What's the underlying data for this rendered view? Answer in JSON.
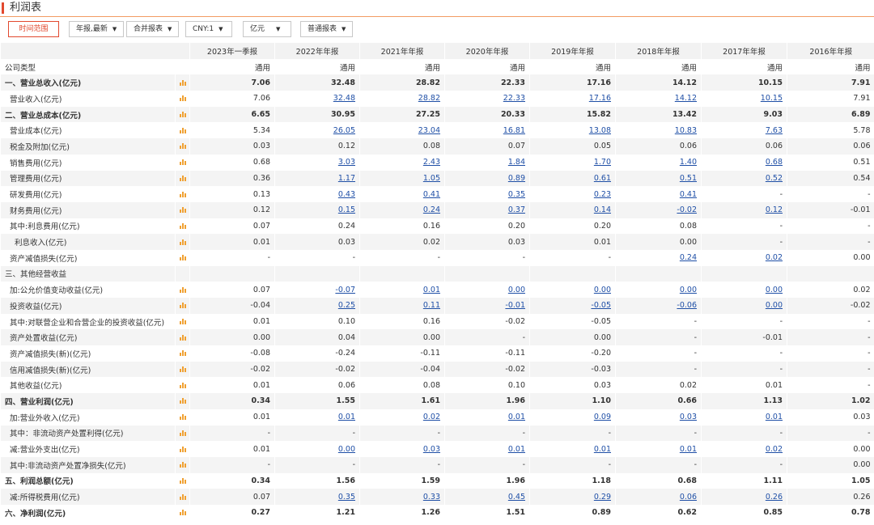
{
  "page_title": "利润表",
  "toolbar": {
    "range_button": "时间范围",
    "report_select": "年报,最新",
    "statement_select": "合并报表",
    "currency_select": "CNY:1",
    "unit_select": "亿元",
    "type_select": "普通报表"
  },
  "columns": [
    "2023年一季报",
    "2022年年报",
    "2021年年报",
    "2020年年报",
    "2019年年报",
    "2018年年报",
    "2017年年报",
    "2016年年报"
  ],
  "rows": [
    {
      "label": "公司类型",
      "bold": false,
      "indent": 0,
      "icon": false,
      "values": [
        "通用",
        "通用",
        "通用",
        "通用",
        "通用",
        "通用",
        "通用",
        "通用"
      ],
      "links": [
        0,
        0,
        0,
        0,
        0,
        0,
        0,
        0
      ]
    },
    {
      "label": "一、营业总收入(亿元)",
      "bold": true,
      "indent": 0,
      "icon": true,
      "values": [
        "7.06",
        "32.48",
        "28.82",
        "22.33",
        "17.16",
        "14.12",
        "10.15",
        "7.91"
      ],
      "links": [
        0,
        0,
        0,
        0,
        0,
        0,
        0,
        0
      ]
    },
    {
      "label": "营业收入(亿元)",
      "bold": false,
      "indent": 1,
      "icon": true,
      "values": [
        "7.06",
        "32.48",
        "28.82",
        "22.33",
        "17.16",
        "14.12",
        "10.15",
        "7.91"
      ],
      "links": [
        0,
        1,
        1,
        1,
        1,
        1,
        1,
        0
      ]
    },
    {
      "label": "二、营业总成本(亿元)",
      "bold": true,
      "indent": 0,
      "icon": true,
      "values": [
        "6.65",
        "30.95",
        "27.25",
        "20.33",
        "15.82",
        "13.42",
        "9.03",
        "6.89"
      ],
      "links": [
        0,
        0,
        0,
        0,
        0,
        0,
        0,
        0
      ]
    },
    {
      "label": "营业成本(亿元)",
      "bold": false,
      "indent": 1,
      "icon": true,
      "values": [
        "5.34",
        "26.05",
        "23.04",
        "16.81",
        "13.08",
        "10.83",
        "7.63",
        "5.78"
      ],
      "links": [
        0,
        1,
        1,
        1,
        1,
        1,
        1,
        0
      ]
    },
    {
      "label": "税金及附加(亿元)",
      "bold": false,
      "indent": 1,
      "icon": true,
      "values": [
        "0.03",
        "0.12",
        "0.08",
        "0.07",
        "0.05",
        "0.06",
        "0.06",
        "0.06"
      ],
      "links": [
        0,
        0,
        0,
        0,
        0,
        0,
        0,
        0
      ]
    },
    {
      "label": "销售费用(亿元)",
      "bold": false,
      "indent": 1,
      "icon": true,
      "values": [
        "0.68",
        "3.03",
        "2.43",
        "1.84",
        "1.70",
        "1.40",
        "0.68",
        "0.51"
      ],
      "links": [
        0,
        1,
        1,
        1,
        1,
        1,
        1,
        0
      ]
    },
    {
      "label": "管理费用(亿元)",
      "bold": false,
      "indent": 1,
      "icon": true,
      "values": [
        "0.36",
        "1.17",
        "1.05",
        "0.89",
        "0.61",
        "0.51",
        "0.52",
        "0.54"
      ],
      "links": [
        0,
        1,
        1,
        1,
        1,
        1,
        1,
        0
      ]
    },
    {
      "label": "研发费用(亿元)",
      "bold": false,
      "indent": 1,
      "icon": true,
      "values": [
        "0.13",
        "0.43",
        "0.41",
        "0.35",
        "0.23",
        "0.41",
        "-",
        "-"
      ],
      "links": [
        0,
        1,
        1,
        1,
        1,
        1,
        0,
        0
      ]
    },
    {
      "label": "财务费用(亿元)",
      "bold": false,
      "indent": 1,
      "icon": true,
      "values": [
        "0.12",
        "0.15",
        "0.24",
        "0.37",
        "0.14",
        "-0.02",
        "0.12",
        "-0.01"
      ],
      "links": [
        0,
        1,
        1,
        1,
        1,
        1,
        1,
        0
      ]
    },
    {
      "label": "其中:利息费用(亿元)",
      "bold": false,
      "indent": 1,
      "icon": true,
      "values": [
        "0.07",
        "0.24",
        "0.16",
        "0.20",
        "0.20",
        "0.08",
        "-",
        "-"
      ],
      "links": [
        0,
        0,
        0,
        0,
        0,
        0,
        0,
        0
      ]
    },
    {
      "label": "利息收入(亿元)",
      "bold": false,
      "indent": 2,
      "icon": true,
      "values": [
        "0.01",
        "0.03",
        "0.02",
        "0.03",
        "0.01",
        "0.00",
        "-",
        "-"
      ],
      "links": [
        0,
        0,
        0,
        0,
        0,
        0,
        0,
        0
      ]
    },
    {
      "label": "资产减值损失(亿元)",
      "bold": false,
      "indent": 1,
      "icon": true,
      "values": [
        "-",
        "-",
        "-",
        "-",
        "-",
        "0.24",
        "0.02",
        "0.00"
      ],
      "links": [
        0,
        0,
        0,
        0,
        0,
        1,
        1,
        0
      ]
    },
    {
      "label": "三、其他经营收益",
      "bold": false,
      "indent": 0,
      "icon": false,
      "values": [
        "",
        "",
        "",
        "",
        "",
        "",
        "",
        ""
      ],
      "links": [
        0,
        0,
        0,
        0,
        0,
        0,
        0,
        0
      ]
    },
    {
      "label": "加:公允价值变动收益(亿元)",
      "bold": false,
      "indent": 1,
      "icon": true,
      "values": [
        "0.07",
        "-0.07",
        "0.01",
        "0.00",
        "0.00",
        "0.00",
        "0.00",
        "0.02"
      ],
      "links": [
        0,
        1,
        1,
        1,
        1,
        1,
        1,
        0
      ]
    },
    {
      "label": "投资收益(亿元)",
      "bold": false,
      "indent": 1,
      "icon": true,
      "values": [
        "-0.04",
        "0.25",
        "0.11",
        "-0.01",
        "-0.05",
        "-0.06",
        "0.00",
        "-0.02"
      ],
      "links": [
        0,
        1,
        1,
        1,
        1,
        1,
        1,
        0
      ]
    },
    {
      "label": "其中:对联营企业和合营企业的投资收益(亿元)",
      "bold": false,
      "indent": 1,
      "icon": true,
      "values": [
        "0.01",
        "0.10",
        "0.16",
        "-0.02",
        "-0.05",
        "-",
        "-",
        "-"
      ],
      "links": [
        0,
        0,
        0,
        0,
        0,
        0,
        0,
        0
      ]
    },
    {
      "label": "资产处置收益(亿元)",
      "bold": false,
      "indent": 1,
      "icon": true,
      "values": [
        "0.00",
        "0.04",
        "0.00",
        "-",
        "0.00",
        "-",
        "-0.01",
        "-"
      ],
      "links": [
        0,
        0,
        0,
        0,
        0,
        0,
        0,
        0
      ]
    },
    {
      "label": "资产减值损失(新)(亿元)",
      "bold": false,
      "indent": 1,
      "icon": true,
      "values": [
        "-0.08",
        "-0.24",
        "-0.11",
        "-0.11",
        "-0.20",
        "-",
        "-",
        "-"
      ],
      "links": [
        0,
        0,
        0,
        0,
        0,
        0,
        0,
        0
      ]
    },
    {
      "label": "信用减值损失(新)(亿元)",
      "bold": false,
      "indent": 1,
      "icon": true,
      "values": [
        "-0.02",
        "-0.02",
        "-0.04",
        "-0.02",
        "-0.03",
        "-",
        "-",
        "-"
      ],
      "links": [
        0,
        0,
        0,
        0,
        0,
        0,
        0,
        0
      ]
    },
    {
      "label": "其他收益(亿元)",
      "bold": false,
      "indent": 1,
      "icon": true,
      "values": [
        "0.01",
        "0.06",
        "0.08",
        "0.10",
        "0.03",
        "0.02",
        "0.01",
        "-"
      ],
      "links": [
        0,
        0,
        0,
        0,
        0,
        0,
        0,
        0
      ]
    },
    {
      "label": "四、营业利润(亿元)",
      "bold": true,
      "indent": 0,
      "icon": true,
      "values": [
        "0.34",
        "1.55",
        "1.61",
        "1.96",
        "1.10",
        "0.66",
        "1.13",
        "1.02"
      ],
      "links": [
        0,
        0,
        0,
        0,
        0,
        0,
        0,
        0
      ]
    },
    {
      "label": "加:营业外收入(亿元)",
      "bold": false,
      "indent": 1,
      "icon": true,
      "values": [
        "0.01",
        "0.01",
        "0.02",
        "0.01",
        "0.09",
        "0.03",
        "0.01",
        "0.03"
      ],
      "links": [
        0,
        1,
        1,
        1,
        1,
        1,
        1,
        0
      ]
    },
    {
      "label": "其中：非流动资产处置利得(亿元)",
      "bold": false,
      "indent": 1,
      "icon": true,
      "values": [
        "-",
        "-",
        "-",
        "-",
        "-",
        "-",
        "-",
        "-"
      ],
      "links": [
        0,
        0,
        0,
        0,
        0,
        0,
        0,
        0
      ]
    },
    {
      "label": "减:营业外支出(亿元)",
      "bold": false,
      "indent": 1,
      "icon": true,
      "values": [
        "0.01",
        "0.00",
        "0.03",
        "0.01",
        "0.01",
        "0.01",
        "0.02",
        "0.00"
      ],
      "links": [
        0,
        1,
        1,
        1,
        1,
        1,
        1,
        0
      ]
    },
    {
      "label": "其中:非流动资产处置净损失(亿元)",
      "bold": false,
      "indent": 1,
      "icon": true,
      "values": [
        "-",
        "-",
        "-",
        "-",
        "-",
        "-",
        "-",
        "0.00"
      ],
      "links": [
        0,
        0,
        0,
        0,
        0,
        0,
        0,
        0
      ]
    },
    {
      "label": "五、利润总额(亿元)",
      "bold": true,
      "indent": 0,
      "icon": true,
      "values": [
        "0.34",
        "1.56",
        "1.59",
        "1.96",
        "1.18",
        "0.68",
        "1.11",
        "1.05"
      ],
      "links": [
        0,
        0,
        0,
        0,
        0,
        0,
        0,
        0
      ]
    },
    {
      "label": "减:所得税费用(亿元)",
      "bold": false,
      "indent": 1,
      "icon": true,
      "values": [
        "0.07",
        "0.35",
        "0.33",
        "0.45",
        "0.29",
        "0.06",
        "0.26",
        "0.26"
      ],
      "links": [
        0,
        1,
        1,
        1,
        1,
        1,
        1,
        0
      ]
    },
    {
      "label": "六、净利润(亿元)",
      "bold": true,
      "indent": 0,
      "icon": true,
      "values": [
        "0.27",
        "1.21",
        "1.26",
        "1.51",
        "0.89",
        "0.62",
        "0.85",
        "0.78"
      ],
      "links": [
        0,
        0,
        0,
        0,
        0,
        0,
        0,
        0
      ]
    }
  ]
}
